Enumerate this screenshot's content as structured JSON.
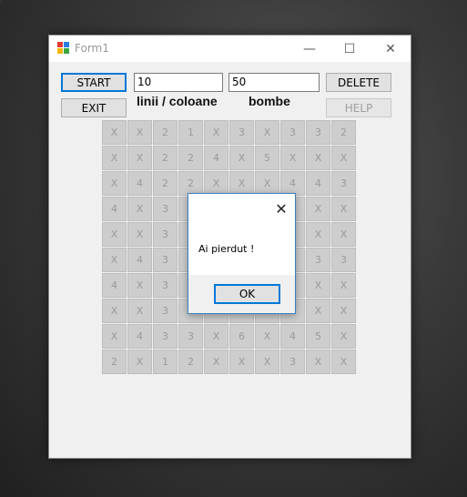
{
  "window": {
    "title": "Form1",
    "minimize_glyph": "—",
    "maximize_glyph": "☐",
    "close_glyph": "✕",
    "app_icon": "form-app-icon"
  },
  "controls": {
    "start_label": "START",
    "exit_label": "EXIT",
    "delete_label": "DELETE",
    "help_label": "HELP",
    "rows_cols_value": "10",
    "bombs_value": "50",
    "rows_cols_label": "linii / coloane",
    "bombs_label": "bombe"
  },
  "grid": {
    "rows": [
      [
        "X",
        "X",
        "2",
        "1",
        "X",
        "3",
        "X",
        "3",
        "3",
        "2"
      ],
      [
        "X",
        "X",
        "2",
        "2",
        "4",
        "X",
        "5",
        "X",
        "X",
        "X"
      ],
      [
        "X",
        "4",
        "2",
        "2",
        "X",
        "X",
        "X",
        "4",
        "4",
        "3"
      ],
      [
        "4",
        "X",
        "3",
        "",
        "",
        "",
        "",
        "3",
        "X",
        "X"
      ],
      [
        "X",
        "X",
        "3",
        "",
        "",
        "",
        "",
        "3",
        "X",
        "X"
      ],
      [
        "X",
        "4",
        "3",
        "",
        "",
        "",
        "",
        "3",
        "3",
        "3"
      ],
      [
        "4",
        "X",
        "3",
        "",
        "",
        "",
        "",
        "3",
        "X",
        "X"
      ],
      [
        "X",
        "X",
        "3",
        "",
        "",
        "",
        "",
        "3",
        "X",
        "X"
      ],
      [
        "X",
        "4",
        "3",
        "3",
        "X",
        "6",
        "X",
        "4",
        "5",
        "X"
      ],
      [
        "2",
        "X",
        "1",
        "2",
        "X",
        "X",
        "X",
        "3",
        "X",
        "X"
      ]
    ]
  },
  "dialog": {
    "message": "Ai pierdut !",
    "ok_label": "OK",
    "close_glyph": "✕"
  }
}
